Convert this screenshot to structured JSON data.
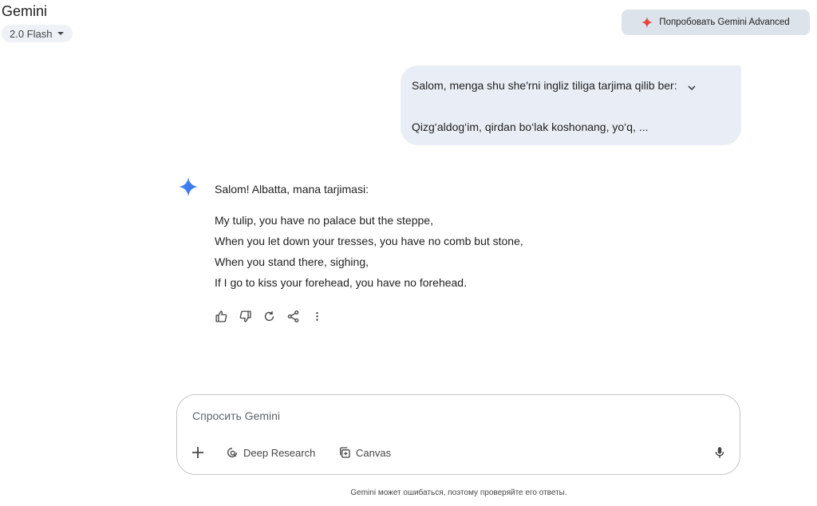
{
  "header": {
    "app_title": "Gemini",
    "model_label": "2.0 Flash",
    "upgrade_label": "Попробовать Gemini Advanced"
  },
  "conversation": {
    "user_message": {
      "line1": "Salom, menga shu she'rni ingliz tiliga tarjima qilib ber:",
      "line2": "Qizg‘aldog‘im, qirdan bo‘lak koshonang, yo‘q, ..."
    },
    "response": {
      "intro": "Salom! Albatta, mana tarjimasi:",
      "poem_lines": [
        "My tulip, you have no palace but the steppe,",
        "When you let down your tresses, you have no comb but stone,",
        "When you stand there, sighing,",
        "If I go to kiss your forehead, you have no forehead."
      ]
    },
    "actions": [
      "thumbs-up-icon",
      "thumbs-down-icon",
      "regenerate-icon",
      "share-icon",
      "more-vert-icon"
    ]
  },
  "composer": {
    "placeholder": "Спросить Gemini",
    "deep_research_label": "Deep Research",
    "canvas_label": "Canvas"
  },
  "footer": {
    "disclaimer": "Gemini может ошибаться, поэтому проверяйте его ответы."
  },
  "colors": {
    "bubble_bg": "#e9eef6",
    "upgrade_bg": "#dde3ea",
    "spark_blue": "#4285f4",
    "spark_red": "#e8453c"
  }
}
